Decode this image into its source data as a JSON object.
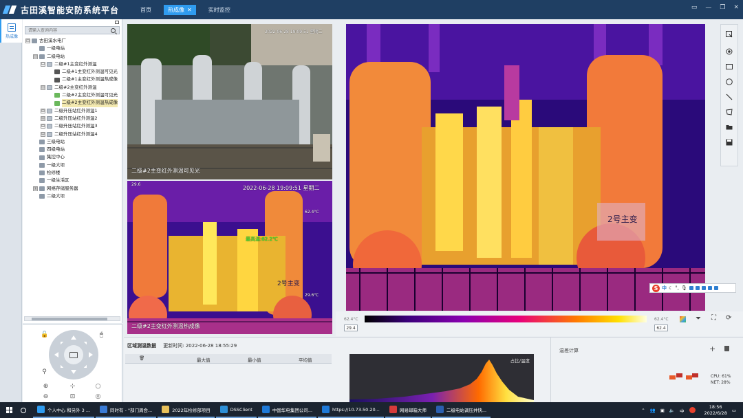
{
  "app": {
    "title": "古田溪智能安防系统平台",
    "nav": [
      {
        "label": "首页"
      },
      {
        "label": "热成像"
      },
      {
        "label": "实时监控"
      }
    ],
    "active_tab_close": "✕"
  },
  "sidebar": {
    "module_label": "热成像"
  },
  "tree": {
    "search_placeholder": "请输入查询内容",
    "nodes": [
      {
        "toggle": "⊟",
        "icon": "folder",
        "label": "古田溪水电厂",
        "level": 0
      },
      {
        "toggle": "",
        "icon": "folder",
        "label": "一级电站",
        "level": 1
      },
      {
        "toggle": "⊟",
        "icon": "folder",
        "label": "二级电站",
        "level": 1
      },
      {
        "toggle": "⊟",
        "icon": "group",
        "label": "二级#1主变红外测温",
        "level": 2
      },
      {
        "toggle": "",
        "icon": "cam",
        "label": "二级#1主变红外测温可见光",
        "level": 3
      },
      {
        "toggle": "",
        "icon": "cam",
        "label": "二级#1主变红外测温热成像",
        "level": 3
      },
      {
        "toggle": "⊟",
        "icon": "group",
        "label": "二级#2主变红外测温",
        "level": 2
      },
      {
        "toggle": "",
        "icon": "camg",
        "label": "二级#2主变红外测温可见光",
        "level": 3
      },
      {
        "toggle": "",
        "icon": "camg",
        "label": "二级#2主变红外测温热成像",
        "level": 3,
        "selected": true
      },
      {
        "toggle": "⊞",
        "icon": "group",
        "label": "二级升压站红外测温1",
        "level": 2
      },
      {
        "toggle": "⊞",
        "icon": "group",
        "label": "二级升压站红外测温2",
        "level": 2
      },
      {
        "toggle": "⊞",
        "icon": "group",
        "label": "二级升压站红外测温3",
        "level": 2
      },
      {
        "toggle": "⊞",
        "icon": "group",
        "label": "二级升压站红外测温4",
        "level": 2
      },
      {
        "toggle": "",
        "icon": "folder",
        "label": "三级电站",
        "level": 1
      },
      {
        "toggle": "",
        "icon": "folder",
        "label": "四级电站",
        "level": 1
      },
      {
        "toggle": "",
        "icon": "folder",
        "label": "集控中心",
        "level": 1
      },
      {
        "toggle": "",
        "icon": "folder",
        "label": "一级大坝",
        "level": 1
      },
      {
        "toggle": "",
        "icon": "folder",
        "label": "检修楼",
        "level": 1
      },
      {
        "toggle": "",
        "icon": "folder",
        "label": "一级生活区",
        "level": 1
      },
      {
        "toggle": "⊞",
        "icon": "folder",
        "label": "网络存储服务器",
        "level": 1
      },
      {
        "toggle": "",
        "icon": "folder",
        "label": "二级大坝",
        "level": 1
      }
    ]
  },
  "videos": {
    "visible": {
      "timestamp": "2022-06-28 19:09:51 星期二",
      "caption": "二级#2主变红外测温可见光"
    },
    "thermal_small": {
      "timestamp": "2022-06-28 19:09:51 星期二",
      "temp_tl": "29.6",
      "temp_tr": "62.4°C",
      "spot_reading": "最高温:62.2℃",
      "temp_br": "29.6℃",
      "caption": "二级#2主变红外测温热成像",
      "nameplate": "2号主变"
    },
    "thermal_main": {
      "nameplate": "2号主变"
    }
  },
  "color_scale": {
    "min_label": "62.4°C",
    "max_label": "62.4°C",
    "min_value": "29.4",
    "max_value": "62.4"
  },
  "stats": {
    "title": "区域测温数据",
    "update_label": "更新时间:",
    "update_time": "2022-06-28 18:55:29",
    "columns": [
      "最大值",
      "最小值",
      "平均值"
    ]
  },
  "histogram": {
    "title": "占比/温度"
  },
  "temp_calc": {
    "title": "温差计算",
    "add": "+"
  },
  "system": {
    "cpu_label": "CPU:",
    "cpu_value": "61%",
    "net_label": "NET:",
    "net_value": "28%"
  },
  "taskbar": {
    "items": [
      {
        "label": "个人中心 和另外 3 ...",
        "color": "#2f9cf0"
      },
      {
        "label": "同时有 - \"部门周会...",
        "color": "#3a7bd5"
      },
      {
        "label": "2022年检修部项目",
        "color": "#e8c15a"
      },
      {
        "label": "DSSClient",
        "color": "#2d8fd6"
      },
      {
        "label": "中国华电集团公司...",
        "color": "#1f7ad8"
      },
      {
        "label": "https://10.73.50.20...",
        "color": "#1f7ad8"
      },
      {
        "label": "网易邮箱大师",
        "color": "#d63b3b"
      },
      {
        "label": "二级电站调压井快...",
        "color": "#2b5fb0"
      }
    ],
    "tray_ime": "中",
    "time": "18:56",
    "date": "2022/6/28"
  },
  "ime": {
    "logo": "S",
    "mode": "中"
  }
}
